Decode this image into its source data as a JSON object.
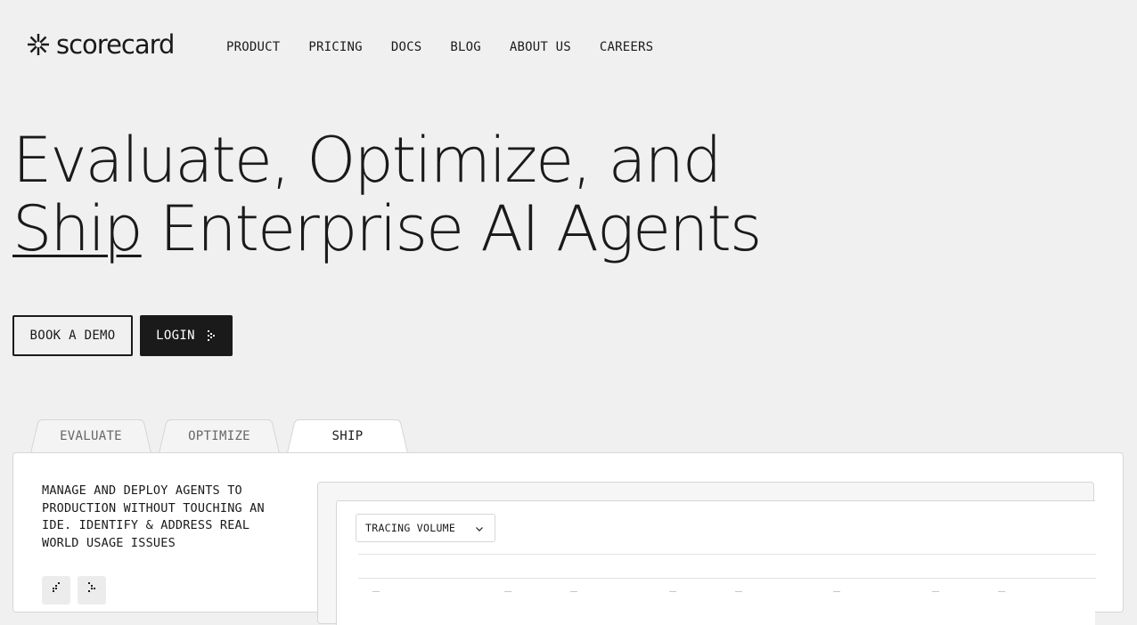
{
  "header": {
    "logo_text": "scorecard",
    "nav": [
      {
        "label": "PRODUCT"
      },
      {
        "label": "PRICING"
      },
      {
        "label": "DOCS"
      },
      {
        "label": "BLOG"
      },
      {
        "label": "ABOUT US"
      },
      {
        "label": "CAREERS"
      }
    ]
  },
  "hero": {
    "title_line1": "Evaluate, Optimize, and",
    "title_underlined": "Ship",
    "title_line2_rest": " Enterprise AI Agents",
    "book_demo_label": "BOOK A DEMO",
    "login_label": "LOGIN"
  },
  "tabs": [
    {
      "label": "EVALUATE",
      "active": false
    },
    {
      "label": "OPTIMIZE",
      "active": false
    },
    {
      "label": "SHIP",
      "active": true
    }
  ],
  "panel": {
    "description": "MANAGE AND DEPLOY AGENTS TO PRODUCTION WITHOUT TOUCHING AN IDE. IDENTIFY & ADDRESS REAL WORLD USAGE ISSUES",
    "preview": {
      "select_value": "TRACING VOLUME"
    }
  },
  "icons": {
    "logo": "asterisk-logo-icon",
    "login": "dotted-arrow-right-icon",
    "select": "chevron-down-icon",
    "prev": "dotted-arrow-left-icon",
    "next": "dotted-arrow-right-icon"
  },
  "colors": {
    "background": "#f0f0f0",
    "text": "#1a1a1a",
    "dark_button": "#1a1a1a",
    "panel": "#ffffff",
    "border": "#d6d6d6"
  }
}
